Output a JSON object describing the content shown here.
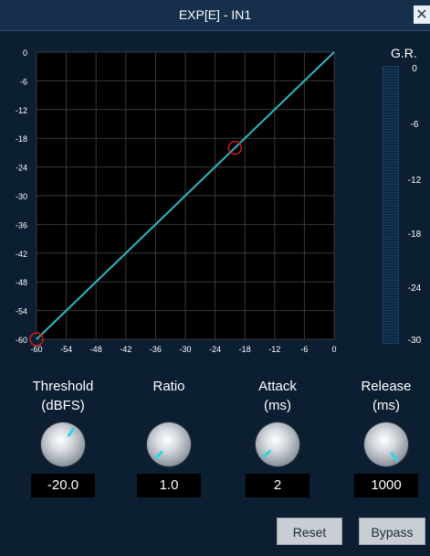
{
  "window": {
    "title": "EXP[E] - IN1",
    "close_glyph": "✕"
  },
  "graph": {
    "y_ticks": [
      "0",
      "-6",
      "-12",
      "-18",
      "-24",
      "-30",
      "-36",
      "-42",
      "-48",
      "-54",
      "-60"
    ],
    "x_ticks": [
      "-60",
      "-54",
      "-48",
      "-42",
      "-36",
      "-30",
      "-24",
      "-18",
      "-12",
      "-6",
      "0"
    ],
    "range_db": [
      -60,
      0
    ],
    "transfer_curve": [
      [
        -60,
        -60
      ],
      [
        0,
        0
      ]
    ],
    "handles": [
      {
        "name": "threshold-point",
        "x_db": -20,
        "y_db": -20
      },
      {
        "name": "floor-point",
        "x_db": -60,
        "y_db": -60
      }
    ],
    "colors": {
      "background": "#000000",
      "grid": "#3a3a3a",
      "line": "#2fb8c4",
      "handle": "#d01c1c"
    }
  },
  "gr_meter": {
    "label": "G.R.",
    "ticks": [
      "0",
      "-6",
      "-12",
      "-18",
      "-24",
      "-30"
    ],
    "range_db": [
      -30,
      0
    ]
  },
  "controls": {
    "threshold": {
      "label_line1": "Threshold",
      "label_line2": "(dBFS)",
      "value": "-20.0",
      "knob_angle_deg": 35
    },
    "ratio": {
      "label_line1": "Ratio",
      "label_line2": "",
      "value": "1.0",
      "knob_angle_deg": -135
    },
    "attack": {
      "label_line1": "Attack",
      "label_line2": "(ms)",
      "value": "2",
      "knob_angle_deg": -130
    },
    "release": {
      "label_line1": "Release",
      "label_line2": "(ms)",
      "value": "1000",
      "knob_angle_deg": 145
    }
  },
  "buttons": {
    "reset": "Reset",
    "bypass": "Bypass"
  },
  "accent_color": "#2fd6e6"
}
